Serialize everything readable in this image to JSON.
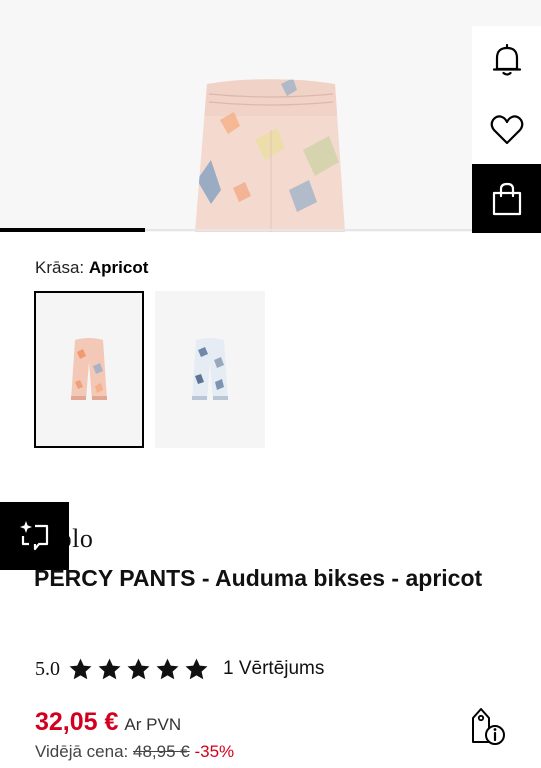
{
  "color": {
    "label": "Krāsa:",
    "value": "Apricot"
  },
  "swatches": [
    {
      "name": "Apricot",
      "selected": true
    },
    {
      "name": "Light blue print",
      "selected": false
    }
  ],
  "product": {
    "brand": "Molo",
    "title": "PERCY PANTS - Auduma bikses - apricot",
    "rating_score": "5.0",
    "rating_stars": 5,
    "reviews": "1 Vērtējums",
    "price": "32,05 €",
    "vat": "Ar PVN",
    "avg_label": "Vidējā cena:",
    "avg_price": "48,95 €",
    "discount": "-35%"
  },
  "gallery": {
    "progress": 0.27
  },
  "icons": {
    "notify": "bell-icon",
    "wishlist": "heart-icon",
    "cart": "shopping-bag-icon",
    "compare": "compare-sparkle-icon",
    "price": "price-tag-info-icon",
    "star": "star-icon"
  },
  "colors": {
    "accent_price": "#d2001e",
    "dark_button": "#000000",
    "product_main": "#f4d9cf",
    "product_alt": "#e4ebf3"
  }
}
